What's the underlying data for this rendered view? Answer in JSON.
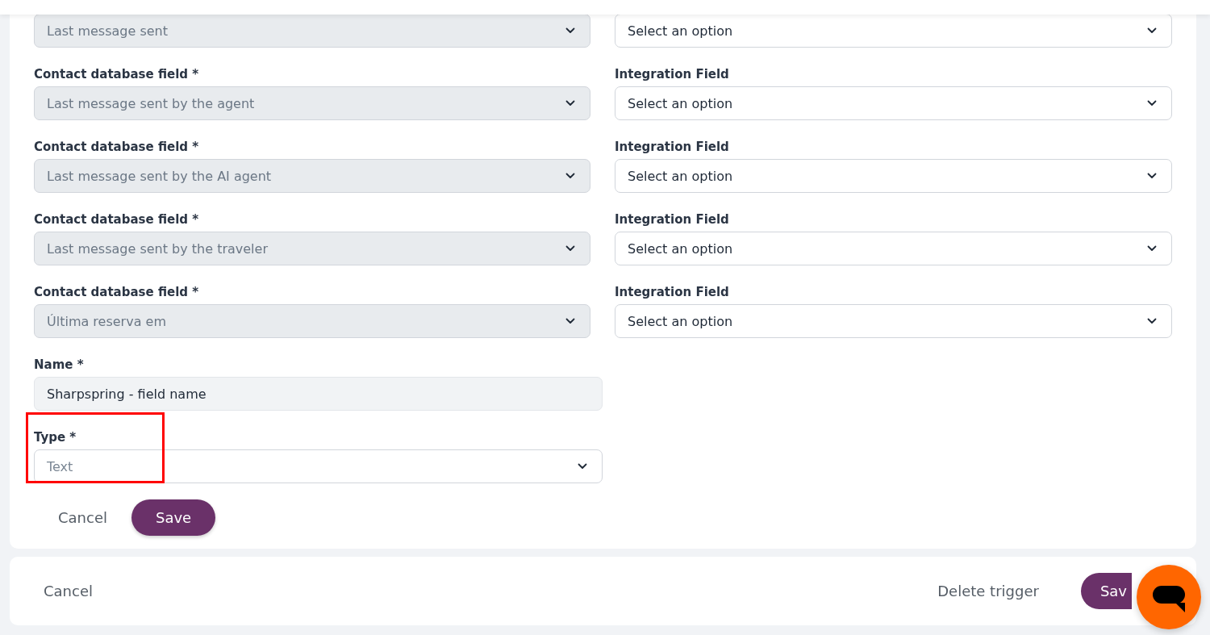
{
  "mappings": [
    {
      "contact_field": {
        "value": "Last message sent",
        "disabled": true
      },
      "integration_field": {
        "placeholder": "Select an option",
        "disabled": false
      }
    },
    {
      "contact_field": {
        "label": "Contact database field *",
        "value": "Last message sent by the agent",
        "disabled": true
      },
      "integration_field": {
        "label": "Integration Field",
        "placeholder": "Select an option",
        "disabled": false
      }
    },
    {
      "contact_field": {
        "label": "Contact database field *",
        "value": "Last message sent by the AI agent",
        "disabled": true
      },
      "integration_field": {
        "label": "Integration Field",
        "placeholder": "Select an option",
        "disabled": false
      }
    },
    {
      "contact_field": {
        "label": "Contact database field *",
        "value": "Last message sent by the traveler",
        "disabled": true
      },
      "integration_field": {
        "label": "Integration Field",
        "placeholder": "Select an option",
        "disabled": false
      }
    },
    {
      "contact_field": {
        "label": "Contact database field *",
        "value": "Última reserva em",
        "disabled": true
      },
      "integration_field": {
        "label": "Integration Field",
        "placeholder": "Select an option",
        "disabled": false
      }
    }
  ],
  "name_field": {
    "label": "Name *",
    "value": "Sharpspring - field name"
  },
  "type_field": {
    "label": "Type *",
    "placeholder": "Text",
    "highlighted": true
  },
  "form_buttons": [
    {
      "label": "Cancel",
      "kind": "plain"
    },
    {
      "label": "Save",
      "kind": "primary"
    }
  ],
  "footer": {
    "buttons": [
      {
        "label": "Cancel",
        "kind": "plain"
      },
      {
        "label": "Delete trigger",
        "kind": "plain"
      },
      {
        "label": "Sav",
        "kind": "primary"
      }
    ]
  }
}
